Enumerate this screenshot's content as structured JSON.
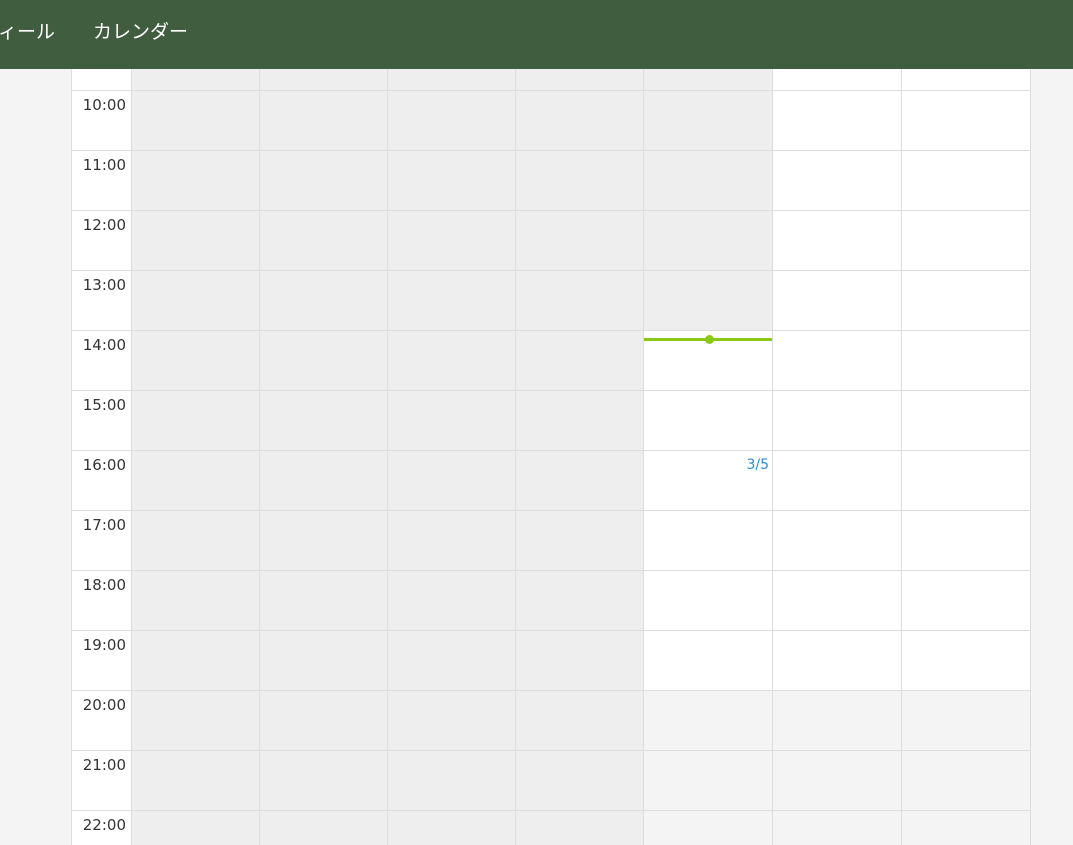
{
  "nav": {
    "items": [
      {
        "label": "ィール"
      },
      {
        "label": "カレンダー"
      }
    ]
  },
  "calendar": {
    "times": [
      "10:00",
      "11:00",
      "12:00",
      "13:00",
      "14:00",
      "15:00",
      "16:00",
      "17:00",
      "18:00",
      "19:00",
      "20:00",
      "21:00",
      "22:00"
    ],
    "date_marker": "3/5",
    "colors": {
      "header_bg": "#415d40",
      "past_bg": "#eeeeee",
      "offhours_bg": "#f4f4f4",
      "now_indicator": "#8ac915",
      "date_link": "#2a90d0"
    }
  }
}
